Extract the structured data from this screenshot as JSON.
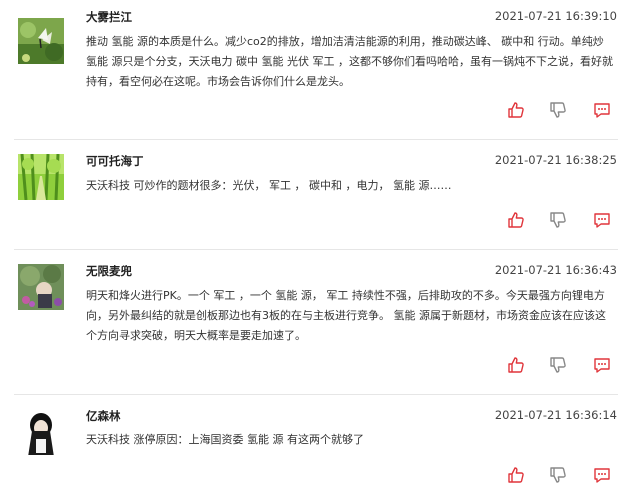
{
  "posts": [
    {
      "username": "大雾拦江",
      "timestamp": "2021-07-21 16:39:10",
      "segments": [
        "推动 ",
        "氢能",
        " 源的本质是什么。减少co2的排放，增加洁清洁能源的利用，推动碳达峰、 ",
        "碳中和",
        " 行动。单纯炒 ",
        "氢能",
        " 源只是个分支，天沃电力 碳中 ",
        "氢能",
        " 光伏 ",
        "军工",
        " ，这都不够你们看吗哈哈，虽有一锅炖不下之说，看好就持有，看空何必在这呢。市场会告诉你们什么是龙头。"
      ]
    },
    {
      "username": "可可托海丁",
      "timestamp": "2021-07-21 16:38:25",
      "segments": [
        "天沃科技 可炒作的题材很多：光伏， ",
        "军工",
        " ， ",
        "碳中和",
        " ，电力， ",
        "氢能",
        " 源……"
      ]
    },
    {
      "username": "无限麦兜",
      "timestamp": "2021-07-21 16:36:43",
      "segments": [
        "明天和烽火进行PK。一个 ",
        "军工",
        " ，一个 ",
        "氢能",
        " 源， ",
        "军工",
        " 持续性不强，后排助攻的不多。今天最强方向锂电方向，另外最纠结的就是创板那边也有3板的在与主板进行竞争。 ",
        "氢能",
        " 源属于新题材，市场资金应该在应该这个方向寻求突破，明天大概率是要走加速了。"
      ]
    },
    {
      "username": "亿森林",
      "timestamp": "2021-07-21 16:36:14",
      "segments": [
        "天沃科技 涨停原因：上海国资委 ",
        "氢能",
        " 源 有这两个就够了"
      ]
    }
  ],
  "icons": {
    "like": "thumbs-up-icon",
    "dislike": "thumbs-down-icon",
    "comment": "comment-bubble-icon"
  },
  "colors": {
    "icon_red": "#e0353b",
    "icon_gray": "#888888",
    "divider": "#e6e6e6"
  }
}
